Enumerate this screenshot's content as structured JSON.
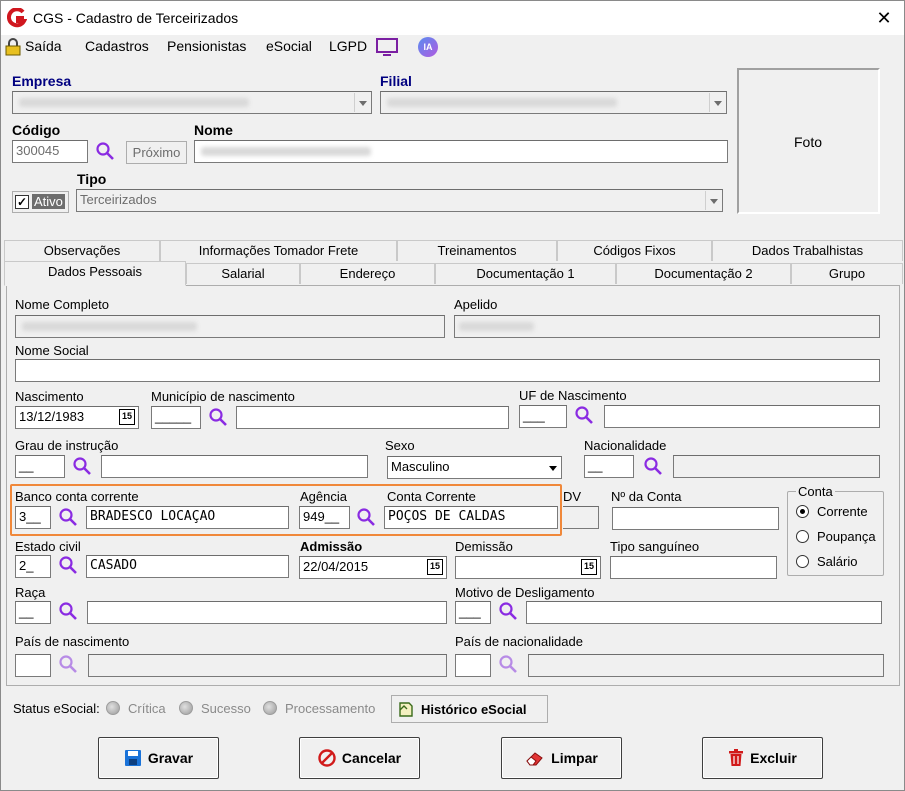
{
  "window": {
    "title": "CGS - Cadastro de Terceirizados",
    "close": "✕"
  },
  "menu": {
    "saida": "Saída",
    "cadastros": "Cadastros",
    "pensionistas": "Pensionistas",
    "esocial": "eSocial",
    "lgpd": "LGPD",
    "ia": "IA"
  },
  "header": {
    "empresa_label": "Empresa",
    "filial_label": "Filial",
    "codigo_label": "Código",
    "codigo_value": "300045",
    "proximo_label": "Próximo",
    "nome_label": "Nome",
    "ativo_label": "Ativo",
    "tipo_label": "Tipo",
    "tipo_value": "Terceirizados",
    "foto_label": "Foto"
  },
  "tabs_top": [
    "Observações",
    "Informações Tomador Frete",
    "Treinamentos",
    "Códigos Fixos",
    "Dados Trabalhistas"
  ],
  "tabs_bottom": [
    "Dados Pessoais",
    "Salarial",
    "Endereço",
    "Documentação 1",
    "Documentação 2",
    "Grupo"
  ],
  "form": {
    "nome_completo_label": "Nome Completo",
    "apelido_label": "Apelido",
    "nome_social_label": "Nome Social",
    "nascimento_label": "Nascimento",
    "nascimento_value": "13/12/1983",
    "municipio_label": "Município de nascimento",
    "municipio_code": "_____",
    "uf_label": "UF de Nascimento",
    "uf_code": "___",
    "grau_label": "Grau de instrução",
    "grau_code": "__",
    "sexo_label": "Sexo",
    "sexo_value": "Masculino",
    "nacionalidade_label": "Nacionalidade",
    "nacionalidade_code": "__",
    "banco_label": "Banco conta corrente",
    "banco_code": "3__",
    "banco_name": "BRADESCO LOCAÇAO",
    "agencia_label": "Agência",
    "agencia_code": "949__",
    "conta_corrente_label": "Conta Corrente",
    "conta_corrente_value": "POÇOS DE CALDAS",
    "dv_label": "DV",
    "num_conta_label": "Nº da Conta",
    "conta_group_label": "Conta",
    "conta_options": [
      "Corrente",
      "Poupança",
      "Salário"
    ],
    "estado_civil_label": "Estado civil",
    "estado_civil_code": "2_",
    "estado_civil_name": "CASADO",
    "admissao_label": "Admissão",
    "admissao_value": "22/04/2015",
    "demissao_label": "Demissão",
    "tipo_sanguineo_label": "Tipo sanguíneo",
    "raca_label": "Raça",
    "raca_code": "__",
    "motivo_label": "Motivo de Desligamento",
    "motivo_code": "___",
    "pais_nasc_label": "País de nascimento",
    "pais_nac_label": "País de nacionalidade",
    "cal_icon": "15"
  },
  "status": {
    "label": "Status eSocial:",
    "critica": "Crítica",
    "sucesso": "Sucesso",
    "processamento": "Processamento",
    "historico": "Histórico eSocial"
  },
  "buttons": {
    "gravar": "Gravar",
    "cancelar": "Cancelar",
    "limpar": "Limpar",
    "excluir": "Excluir"
  },
  "colors": {
    "highlight": "#f0883a",
    "accent_purple": "#8a2be2",
    "navy": "#000080"
  }
}
